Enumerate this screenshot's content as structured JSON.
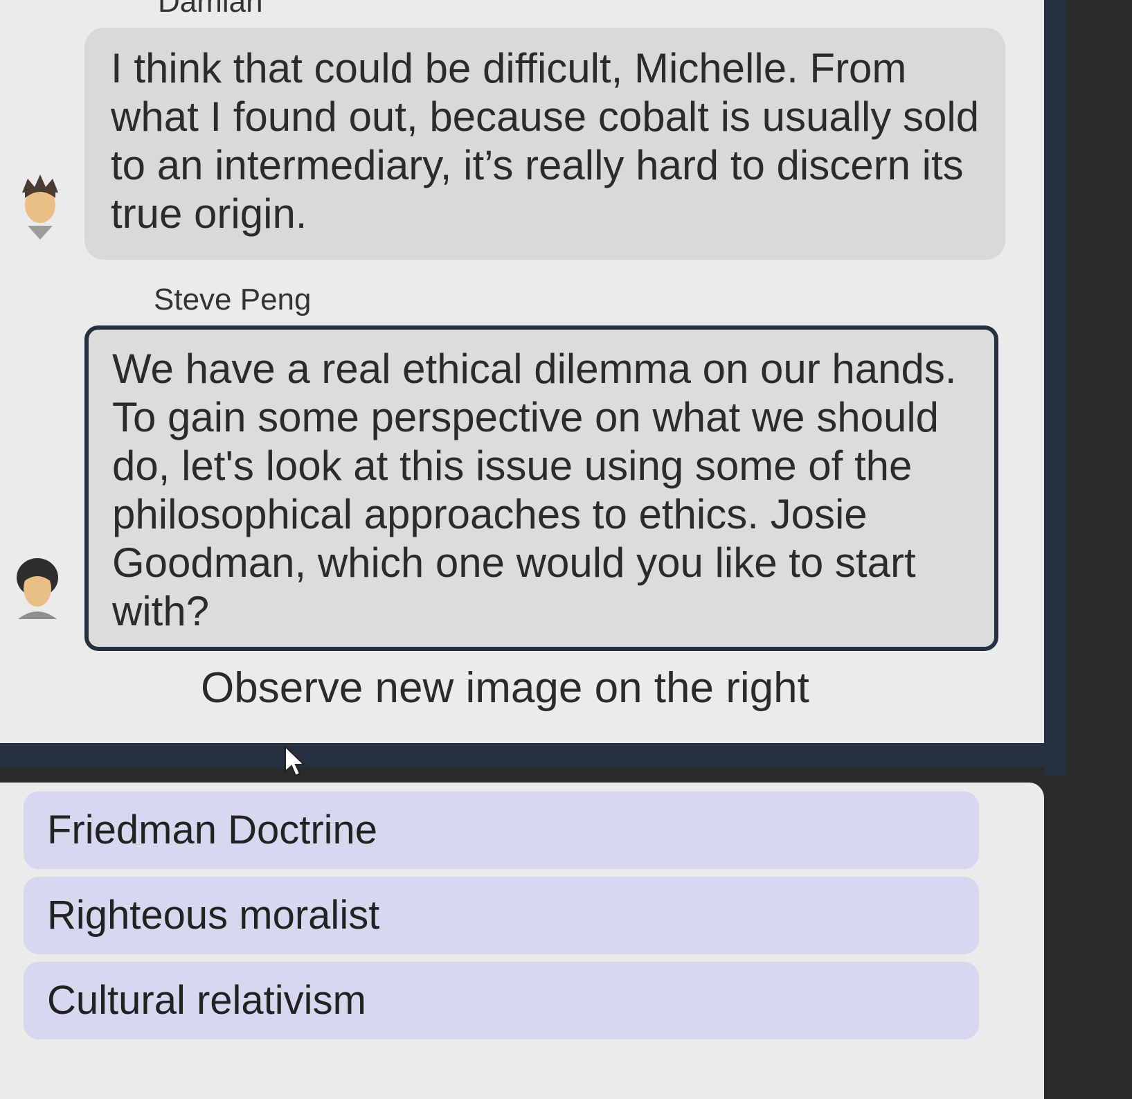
{
  "messages": [
    {
      "speaker": "Damian",
      "text": "I think that could be difficult, Michelle. From what I found out, because cobalt is usually sold to an intermediary, it’s really hard to discern its true origin."
    },
    {
      "speaker": "Steve Peng",
      "text": "We have a real ethical dilemma on our hands. To gain some perspective on what we should do, let's look at this issue using some of the philosophical approaches to ethics. Josie Goodman, which one would you like to start with?"
    }
  ],
  "instruction": "Observe new image on the right",
  "options": [
    {
      "label": "Friedman Doctrine"
    },
    {
      "label": "Righteous moralist"
    },
    {
      "label": "Cultural relativism"
    }
  ],
  "colors": {
    "panel_bg": "#ebebeb",
    "frame": "#253140",
    "bubble_gray": "#d9d9d9",
    "option_bg": "#d5d8ee"
  },
  "icons": [
    "avatar-damian-icon",
    "avatar-steve-icon",
    "mouse-cursor-icon"
  ]
}
